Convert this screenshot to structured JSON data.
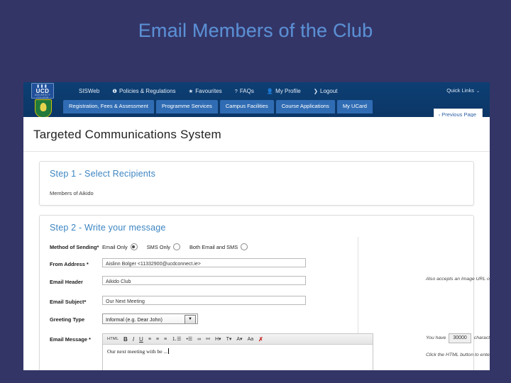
{
  "slide": {
    "title": "Email Members of the Club",
    "background_color": "#333566",
    "title_color": "#5b8fd4"
  },
  "screenshot": {
    "header": {
      "logo_alt": "UCD",
      "logo_sub": "UNIVERSITY COLLEGE DUBLIN",
      "logo_pips": "▮▮▮",
      "quick_links": "Quick Links",
      "quick_links_caret": "⌄",
      "top_nav": [
        {
          "label": "SISWeb",
          "icon": ""
        },
        {
          "label": "Policies & Regulations",
          "icon": "❶"
        },
        {
          "label": "Favourites",
          "icon": "★"
        },
        {
          "label": "FAQs",
          "icon": "?"
        },
        {
          "label": "My Profile",
          "icon": "👤"
        },
        {
          "label": "Logout",
          "icon": "❯"
        }
      ],
      "tabs": [
        {
          "label": "Registration, Fees & Assessment"
        },
        {
          "label": "Programme Services"
        },
        {
          "label": "Campus Facilities"
        },
        {
          "label": "Course Applications"
        },
        {
          "label": "My UCard"
        }
      ],
      "previous_page": "Previous Page",
      "previous_page_chevron": "‹",
      "bar_color": "#0b3d72",
      "tab_color": "#2e6cb5"
    },
    "page_title": "Targeted Communications System",
    "step1": {
      "heading": "Step 1 - Select Recipients",
      "recipients": "Members of Aikido"
    },
    "step2": {
      "heading": "Step 2 - Write your message",
      "method_label": "Method of Sending",
      "method_required": "*",
      "method_options": [
        {
          "label": "Email Only",
          "selected": true
        },
        {
          "label": "SMS Only",
          "selected": false
        },
        {
          "label": "Both Email and SMS",
          "selected": false
        }
      ],
      "from_address_label": "From Address *",
      "from_address_value": "Aislinn Bolger <11332900@ucdconnect.ie>",
      "email_header_label": "Email Header",
      "email_header_value": "Aikido Club",
      "email_header_hint": "Also accepts an Image URL or NONE for no header",
      "email_subject_label": "Email Subject*",
      "email_subject_value": "Our Next Meeting",
      "greeting_type_label": "Greeting Type",
      "greeting_type_value": "Informal (e.g. Dear John)",
      "greeting_type_arrow": "▼",
      "email_message_label": "Email Message *",
      "email_message_value": "Our next meeting with be ...",
      "chars_prefix": "You have",
      "chars_value": "30000",
      "chars_suffix": "characters left",
      "html_hint": "Click the HTML button to enter a HTML message.",
      "toolbar": [
        {
          "name": "html-button",
          "label": "HTML",
          "style": "html"
        },
        {
          "name": "bold-button",
          "label": "B",
          "style": "bold"
        },
        {
          "name": "italic-button",
          "label": "I",
          "style": "ital"
        },
        {
          "name": "underline-button",
          "label": "U",
          "style": "und"
        },
        {
          "name": "align-left-icon",
          "label": "≡",
          "style": ""
        },
        {
          "name": "align-center-icon",
          "label": "≡",
          "style": ""
        },
        {
          "name": "align-right-icon",
          "label": "≡",
          "style": ""
        },
        {
          "name": "numbered-list-icon",
          "label": "⒈☰",
          "style": ""
        },
        {
          "name": "bullet-list-icon",
          "label": "•☰",
          "style": ""
        },
        {
          "name": "link-icon",
          "label": "∞",
          "style": ""
        },
        {
          "name": "unlink-icon",
          "label": "⚯",
          "style": ""
        },
        {
          "name": "heading-dropdown",
          "label": "H▾",
          "style": ""
        },
        {
          "name": "font-dropdown",
          "label": "T▾",
          "style": ""
        },
        {
          "name": "font-size-dropdown",
          "label": "A▾",
          "style": ""
        },
        {
          "name": "text-color-button",
          "label": "Aa",
          "style": ""
        },
        {
          "name": "clear-formatting-button",
          "label": "✗",
          "style": "red"
        }
      ]
    }
  }
}
